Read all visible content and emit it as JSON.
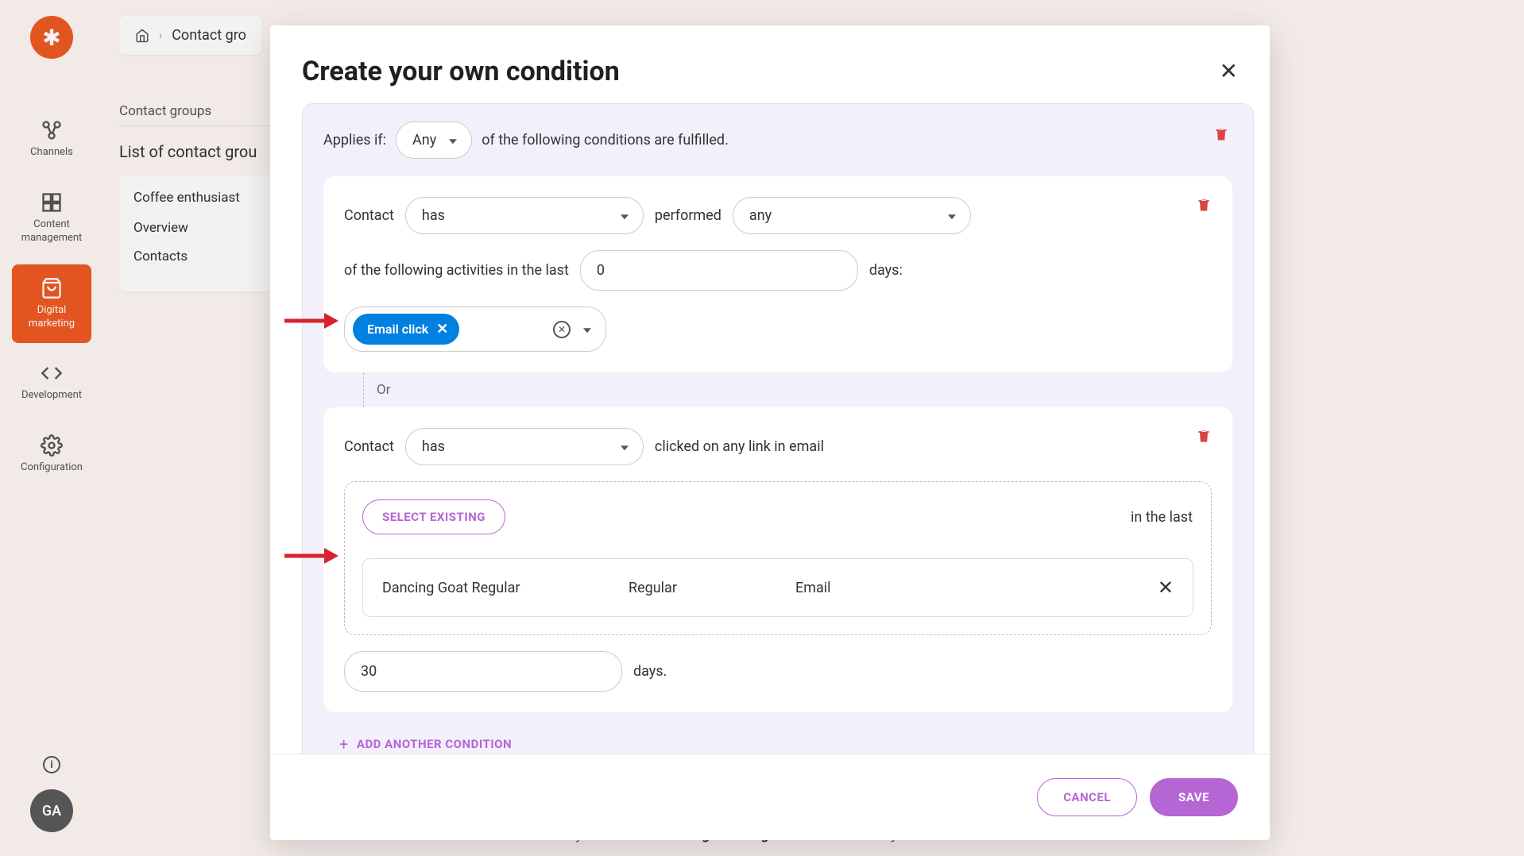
{
  "breadcrumb": {
    "current": "Contact gro"
  },
  "sidebar": {
    "items": [
      {
        "label": "Channels"
      },
      {
        "label": "Content management"
      },
      {
        "label": "Digital marketing"
      },
      {
        "label": "Development"
      },
      {
        "label": "Configuration"
      }
    ],
    "avatar": "GA"
  },
  "leftPanel": {
    "title": "Contact groups",
    "listHeading": "List of contact grou",
    "groupName": "Coffee enthusiast",
    "links": [
      "Overview",
      "Contacts"
    ]
  },
  "modal": {
    "title": "Create your own condition",
    "appliesLabel": "Applies if:",
    "appliesSelect": "Any",
    "appliesSuffix": "of the following conditions are fulfilled.",
    "cond1": {
      "contactLabel": "Contact",
      "hasSelect": "has",
      "performedLabel": "performed",
      "anySelect": "any",
      "ofLabel": "of the following activities in the last",
      "daysValue": "0",
      "daysLabel": "days:",
      "tag": "Email click"
    },
    "or": "Or",
    "cond2": {
      "contactLabel": "Contact",
      "hasSelect": "has",
      "clickedLabel": "clicked on any link in email",
      "selectExisting": "SELECT EXISTING",
      "emailName": "Dancing Goat Regular",
      "emailType": "Regular",
      "emailChannel": "Email",
      "inLastLabel": "in the last",
      "daysValue": "30",
      "daysLabel": "days."
    },
    "addAnother": "ADD ANOTHER CONDITION",
    "cancel": "CANCEL",
    "save": "SAVE"
  },
  "summary": {
    "prefix": "Contact ",
    "has": "has",
    "mid": " clicked on any link in email ",
    "name": "Dancing Goat Regular",
    "suffix": " in the last ",
    "days": "30",
    "end": " days."
  }
}
